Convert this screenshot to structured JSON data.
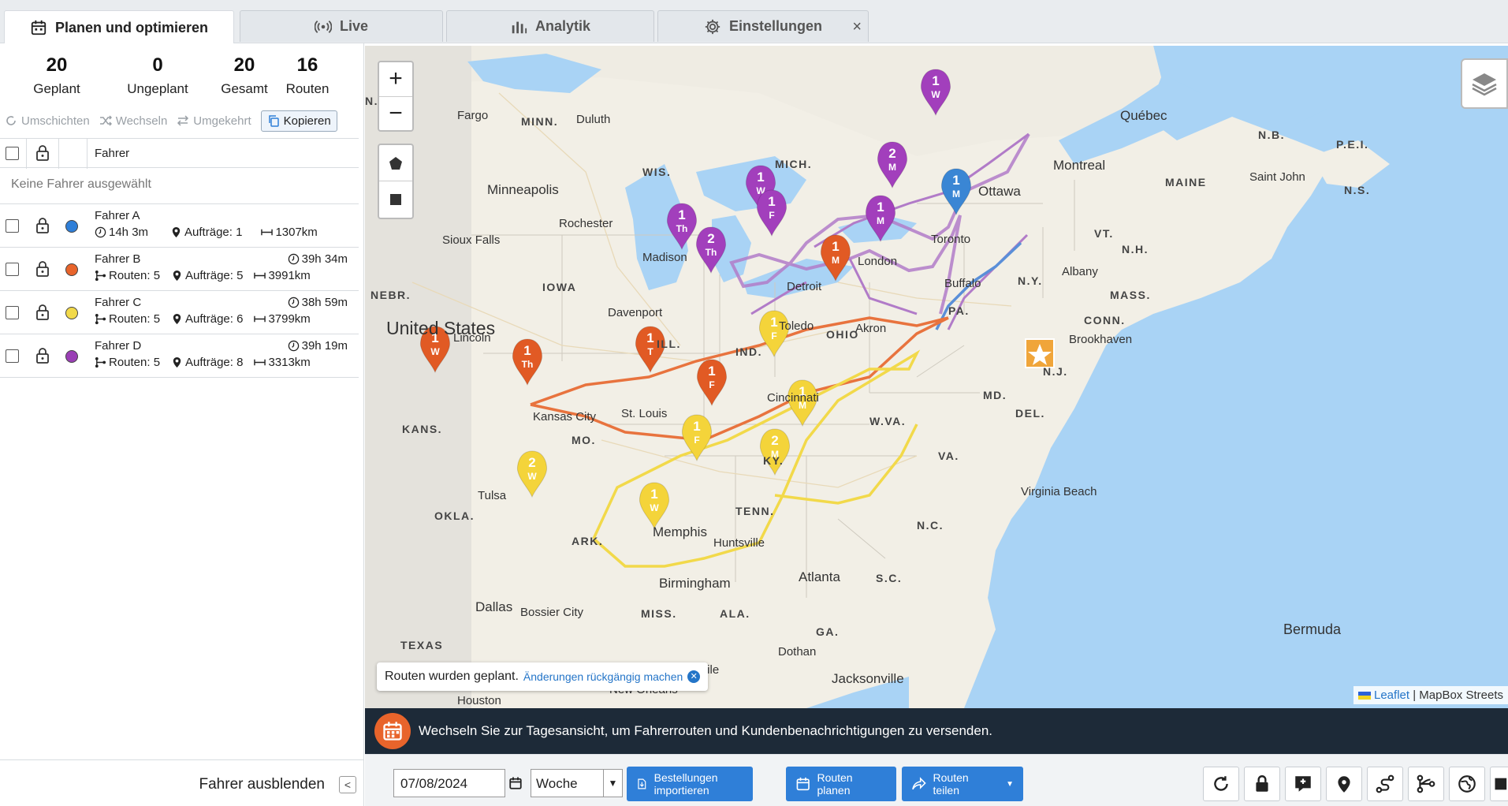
{
  "tabs": [
    {
      "label": "Planen und optimieren",
      "icon": "calendar-icon",
      "active": true
    },
    {
      "label": "Live",
      "icon": "broadcast-icon"
    },
    {
      "label": "Analytik",
      "icon": "bar-chart-icon"
    },
    {
      "label": "Einstellungen",
      "icon": "gear-icon"
    }
  ],
  "tab_close": "×",
  "stats": [
    {
      "value": "20",
      "label": "Geplant"
    },
    {
      "value": "0",
      "label": "Ungeplant"
    },
    {
      "value": "20",
      "label": "Gesamt"
    },
    {
      "value": "16",
      "label": "Routen"
    }
  ],
  "actions": {
    "reschedule": "Umschichten",
    "swap": "Wechseln",
    "reverse": "Umgekehrt",
    "copy": "Kopieren"
  },
  "table": {
    "header_driver": "Fahrer",
    "empty_note": "Keine Fahrer ausgewählt"
  },
  "drivers": [
    {
      "name": "Fahrer A",
      "color": "#2f7fd8",
      "duration": "14h 3m",
      "routes": "",
      "orders": "Aufträge: 1",
      "distance": "1307km"
    },
    {
      "name": "Fahrer B",
      "color": "#e8642b",
      "duration": "39h 34m",
      "routes": "Routen: 5",
      "orders": "Aufträge: 5",
      "distance": "3991km"
    },
    {
      "name": "Fahrer C",
      "color": "#f2d94a",
      "duration": "38h 59m",
      "routes": "Routen: 5",
      "orders": "Aufträge: 6",
      "distance": "3799km"
    },
    {
      "name": "Fahrer D",
      "color": "#9a3fb5",
      "duration": "39h 19m",
      "routes": "Routen: 5",
      "orders": "Aufträge: 8",
      "distance": "3313km"
    }
  ],
  "sidebar_footer": {
    "hide_label": "Fahrer ausblenden",
    "collapse": "<"
  },
  "map": {
    "zoom_in": "+",
    "zoom_out": "−",
    "toast_text": "Routen wurden geplant.",
    "toast_undo": "Änderungen rückgängig machen",
    "attribution_link": "Leaflet",
    "attribution_text": "| MapBox Streets",
    "country_label": "United States",
    "states": [
      "MINN.",
      "WIS.",
      "MICH.",
      "IOWA",
      "NEBR.",
      "ILL.",
      "IND.",
      "OHIO",
      "PA.",
      "N.Y.",
      "VT.",
      "N.H.",
      "MAINE",
      "MASS.",
      "CONN.",
      "N.J.",
      "MD.",
      "DEL.",
      "W.VA.",
      "VA.",
      "KY.",
      "TENN.",
      "N.C.",
      "S.C.",
      "GA.",
      "ALA.",
      "MISS.",
      "ARK.",
      "MO.",
      "KANS.",
      "OKLA.",
      "TEXAS",
      "N.B.",
      "P.E.I.",
      "N.S.",
      "N."
    ],
    "cities": [
      "Fargo",
      "Duluth",
      "Minneapolis",
      "Rochester",
      "Sioux Falls",
      "Madison",
      "Davenport",
      "Lincoln",
      "Kansas City",
      "St. Louis",
      "Cincinnati",
      "Detroit",
      "Toledo",
      "Akron",
      "London",
      "Toronto",
      "Buffalo",
      "Ottawa",
      "Montreal",
      "Québec",
      "Saint John",
      "Albany",
      "Brookhaven",
      "Virginia Beach",
      "Tulsa",
      "Memphis",
      "Huntsville",
      "Birmingham",
      "Atlanta",
      "Dallas",
      "Bossier City",
      "Dothan",
      "Jacksonville",
      "Mobile",
      "New Orleans",
      "Houston",
      "Bermuda"
    ],
    "markers": [
      {
        "route": "D",
        "num": "1",
        "day": "W"
      },
      {
        "route": "D",
        "num": "2",
        "day": "M"
      },
      {
        "route": "D",
        "num": "1",
        "day": "W"
      },
      {
        "route": "D",
        "num": "1",
        "day": "F"
      },
      {
        "route": "D",
        "num": "1",
        "day": "Th"
      },
      {
        "route": "D",
        "num": "2",
        "day": "Th"
      },
      {
        "route": "D",
        "num": "1",
        "day": "M"
      },
      {
        "route": "A",
        "num": "1",
        "day": "M"
      },
      {
        "route": "B",
        "num": "1",
        "day": "M"
      },
      {
        "route": "B",
        "num": "1",
        "day": "W"
      },
      {
        "route": "B",
        "num": "1",
        "day": "Th"
      },
      {
        "route": "B",
        "num": "1",
        "day": "T"
      },
      {
        "route": "B",
        "num": "1",
        "day": "F"
      },
      {
        "route": "C",
        "num": "1",
        "day": "F"
      },
      {
        "route": "C",
        "num": "1",
        "day": "M"
      },
      {
        "route": "C",
        "num": "1",
        "day": "F"
      },
      {
        "route": "C",
        "num": "2",
        "day": "M"
      },
      {
        "route": "C",
        "num": "2",
        "day": "W"
      },
      {
        "route": "C",
        "num": "1",
        "day": "W"
      }
    ]
  },
  "banner": {
    "text": "Wechseln Sie zur Tagesansicht, um Fahrerrouten und Kundenbenachrichtigungen zu versenden."
  },
  "bottombar": {
    "date_value": "07/08/2024",
    "period": "Woche",
    "import_label": "Bestellungen importieren",
    "plan_label": "Routen planen",
    "share_label": "Routen teilen",
    "tools": [
      "refresh-icon",
      "lock-icon",
      "comment-pin-icon",
      "map-pin-icon",
      "route-icon",
      "branch-route-icon",
      "globe-icon",
      "panel-icon"
    ]
  }
}
